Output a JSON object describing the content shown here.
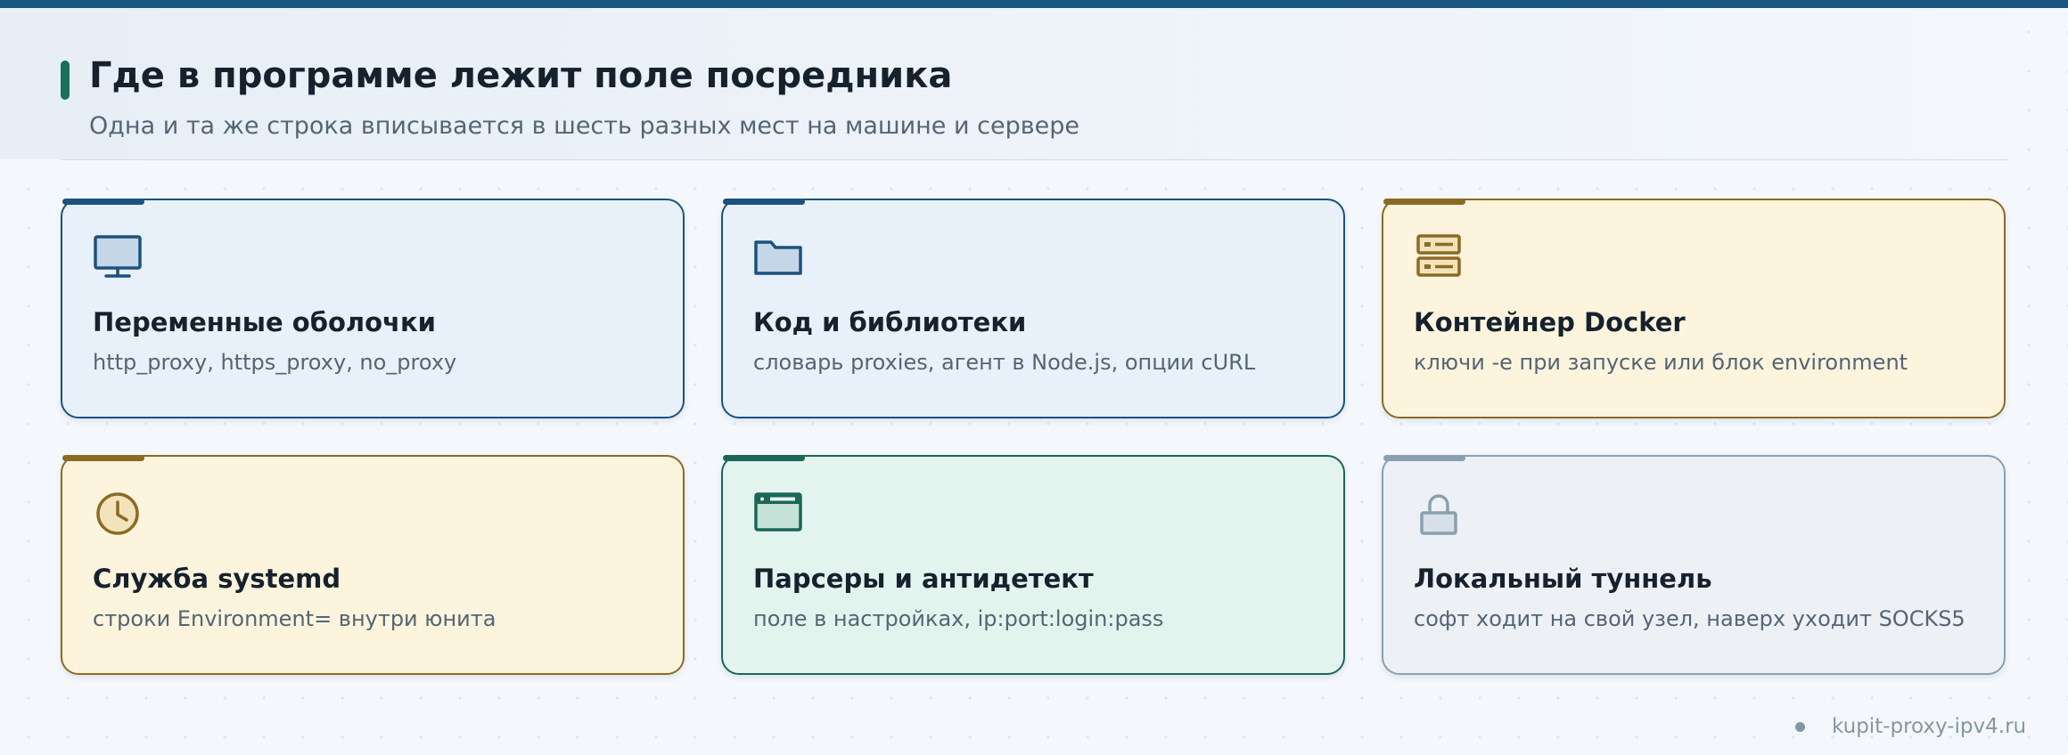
{
  "header": {
    "title": "Где в программе лежит поле посредника",
    "subtitle": "Одна и та же строка вписывается в шесть разных мест на машине и сервере"
  },
  "cards": [
    {
      "title": "Переменные оболочки",
      "description": "http_proxy, https_proxy, no_proxy",
      "icon": "monitor-icon",
      "accent": "#1b527e"
    },
    {
      "title": "Код и библиотеки",
      "description": "словарь proxies, агент в Node.js, опции cURL",
      "icon": "folder-icon",
      "accent": "#1b527e"
    },
    {
      "title": "Контейнер Docker",
      "description": "ключи -e при запуске или блок environment",
      "icon": "server-icon",
      "accent": "#8b6a24"
    },
    {
      "title": "Служба systemd",
      "description": "строки Environment= внутри юнита",
      "icon": "clock-icon",
      "accent": "#8b6a24"
    },
    {
      "title": "Парсеры и антидетект",
      "description": "поле в настройках, ip:port:login:pass",
      "icon": "browser-window-icon",
      "accent": "#1b6657"
    },
    {
      "title": "Локальный туннель",
      "description": "софт ходит на свой узел, наверх уходит SOCKS5",
      "icon": "lock-icon",
      "accent": "#8aa0b0"
    }
  ],
  "footer": {
    "site": "kupit-proxy-ipv4.ru"
  },
  "colors": {
    "top_bar": "#18557f",
    "header_accent": "#1b6e57",
    "blue": "#1b527e",
    "gold": "#8b6a24",
    "green": "#1b6657",
    "gray": "#8aa0b0"
  }
}
